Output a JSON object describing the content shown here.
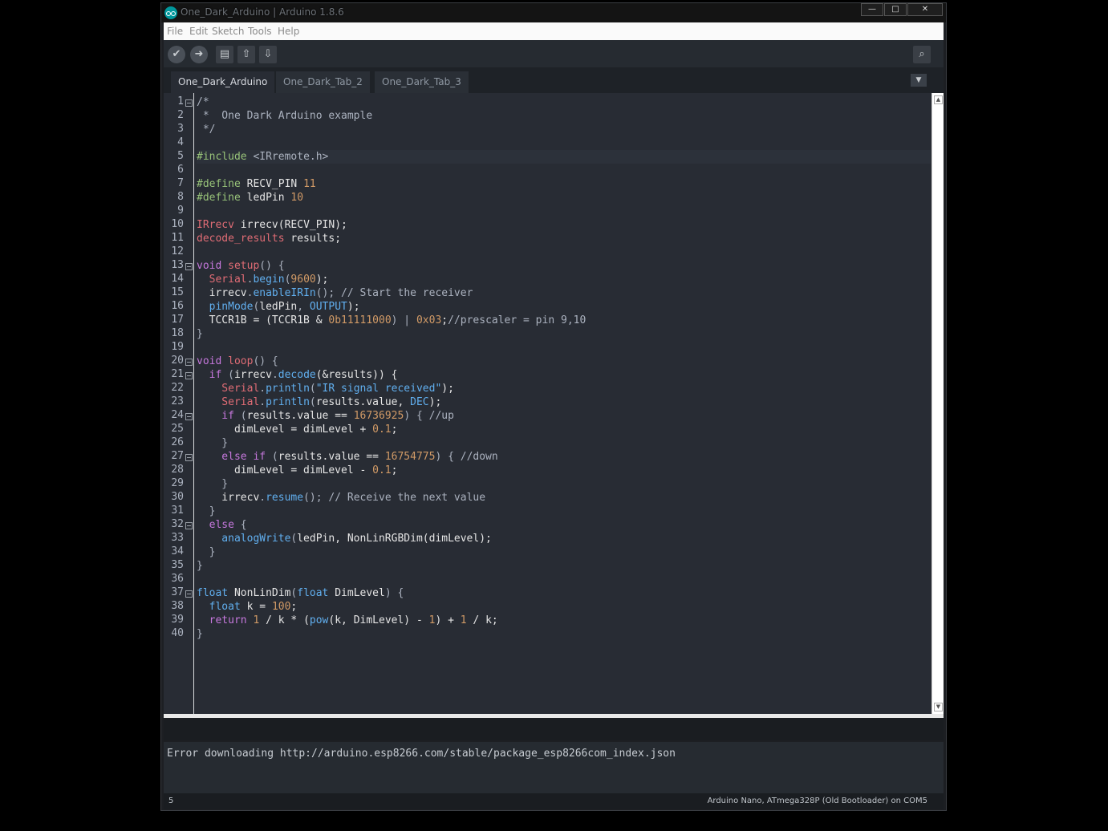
{
  "window": {
    "title": "One_Dark_Arduino | Arduino 1.8.6",
    "controls": {
      "minimize": "—",
      "maximize": "□",
      "close": "✕"
    }
  },
  "menubar": {
    "items": [
      "File",
      "Edit",
      "Sketch",
      "Tools",
      "Help"
    ]
  },
  "toolbar": {
    "verify_icon": "check-icon",
    "upload_icon": "arrow-right-icon",
    "new_icon": "file-icon",
    "open_icon": "arrow-up-icon",
    "save_icon": "arrow-down-icon",
    "serial_monitor_icon": "magnifier-icon"
  },
  "tabs": [
    {
      "label": "One_Dark_Arduino",
      "active": true
    },
    {
      "label": "One_Dark_Tab_2",
      "active": false
    },
    {
      "label": "One_Dark_Tab_3",
      "active": false
    }
  ],
  "editor": {
    "current_line": 5,
    "lines": [
      [
        [
          "/*",
          "#abb2bf"
        ]
      ],
      [
        [
          " *  One Dark Arduino example",
          "#abb2bf"
        ]
      ],
      [
        [
          " */",
          "#abb2bf"
        ]
      ],
      [],
      [
        [
          "#include ",
          "#98c379"
        ],
        [
          "<IRremote.h>",
          "#abb2bf"
        ]
      ],
      [],
      [
        [
          "#define ",
          "#98c379"
        ],
        [
          "RECV_PIN ",
          "#e5e5e5"
        ],
        [
          "11",
          "#d19a66"
        ]
      ],
      [
        [
          "#define ",
          "#98c379"
        ],
        [
          "ledPin ",
          "#e5e5e5"
        ],
        [
          "10",
          "#d19a66"
        ]
      ],
      [],
      [
        [
          "IRrecv ",
          "#e06c75"
        ],
        [
          "irrecv(RECV_PIN);",
          "#e5e5e5"
        ]
      ],
      [
        [
          "decode_results ",
          "#e06c75"
        ],
        [
          "results;",
          "#e5e5e5"
        ]
      ],
      [],
      [
        [
          "void ",
          "#c678dd"
        ],
        [
          "setup",
          "#e06c75"
        ],
        [
          "() {",
          "#abb2bf"
        ]
      ],
      [
        [
          "  Serial",
          "#e06c75"
        ],
        [
          ".",
          "#abb2bf"
        ],
        [
          "begin",
          "#61afef"
        ],
        [
          "(",
          "#abb2bf"
        ],
        [
          "9600",
          "#d19a66"
        ],
        [
          ");",
          "#e5e5e5"
        ]
      ],
      [
        [
          "  irrecv",
          "#e5e5e5"
        ],
        [
          ".",
          "#abb2bf"
        ],
        [
          "enableIRIn",
          "#61afef"
        ],
        [
          "(); ",
          "#abb2bf"
        ],
        [
          "// Start the receiver",
          "#abb2bf"
        ]
      ],
      [
        [
          "  pinMode",
          "#61afef"
        ],
        [
          "(",
          "#abb2bf"
        ],
        [
          "ledPin",
          "#e5e5e5"
        ],
        [
          ", ",
          "#abb2bf"
        ],
        [
          "OUTPUT",
          "#61afef"
        ],
        [
          ");",
          "#e5e5e5"
        ]
      ],
      [
        [
          "  TCCR1B = (TCCR1B & ",
          "#e5e5e5"
        ],
        [
          "0b11111000",
          "#d19a66"
        ],
        [
          ") | ",
          "#abb2bf"
        ],
        [
          "0x03",
          "#d19a66"
        ],
        [
          ";",
          "#e5e5e5"
        ],
        [
          "//prescaler = pin 9,10",
          "#abb2bf"
        ]
      ],
      [
        [
          "}",
          "#abb2bf"
        ]
      ],
      [],
      [
        [
          "void ",
          "#c678dd"
        ],
        [
          "loop",
          "#e06c75"
        ],
        [
          "() {",
          "#abb2bf"
        ]
      ],
      [
        [
          "  if ",
          "#c678dd"
        ],
        [
          "(",
          "#abb2bf"
        ],
        [
          "irrecv",
          "#e5e5e5"
        ],
        [
          ".",
          "#abb2bf"
        ],
        [
          "decode",
          "#61afef"
        ],
        [
          "(&results)) {",
          "#e5e5e5"
        ]
      ],
      [
        [
          "    Serial",
          "#e06c75"
        ],
        [
          ".",
          "#abb2bf"
        ],
        [
          "println",
          "#61afef"
        ],
        [
          "(",
          "#abb2bf"
        ],
        [
          "\"IR signal received\"",
          "#61afef"
        ],
        [
          ");",
          "#e5e5e5"
        ]
      ],
      [
        [
          "    Serial",
          "#e06c75"
        ],
        [
          ".",
          "#abb2bf"
        ],
        [
          "println",
          "#61afef"
        ],
        [
          "(",
          "#abb2bf"
        ],
        [
          "results.value, ",
          "#e5e5e5"
        ],
        [
          "DEC",
          "#61afef"
        ],
        [
          ");",
          "#e5e5e5"
        ]
      ],
      [
        [
          "    if ",
          "#c678dd"
        ],
        [
          "(",
          "#abb2bf"
        ],
        [
          "results.value == ",
          "#e5e5e5"
        ],
        [
          "16736925",
          "#d19a66"
        ],
        [
          ") { ",
          "#abb2bf"
        ],
        [
          "//up",
          "#abb2bf"
        ]
      ],
      [
        [
          "      dimLevel = dimLevel + ",
          "#e5e5e5"
        ],
        [
          "0.1",
          "#d19a66"
        ],
        [
          ";",
          "#e5e5e5"
        ]
      ],
      [
        [
          "    }",
          "#abb2bf"
        ]
      ],
      [
        [
          "    else if ",
          "#c678dd"
        ],
        [
          "(",
          "#abb2bf"
        ],
        [
          "results.value == ",
          "#e5e5e5"
        ],
        [
          "16754775",
          "#d19a66"
        ],
        [
          ") { ",
          "#abb2bf"
        ],
        [
          "//down",
          "#abb2bf"
        ]
      ],
      [
        [
          "      dimLevel = dimLevel - ",
          "#e5e5e5"
        ],
        [
          "0.1",
          "#d19a66"
        ],
        [
          ";",
          "#e5e5e5"
        ]
      ],
      [
        [
          "    }",
          "#abb2bf"
        ]
      ],
      [
        [
          "    irrecv",
          "#e5e5e5"
        ],
        [
          ".",
          "#abb2bf"
        ],
        [
          "resume",
          "#61afef"
        ],
        [
          "(); ",
          "#abb2bf"
        ],
        [
          "// Receive the next value",
          "#abb2bf"
        ]
      ],
      [
        [
          "  }",
          "#abb2bf"
        ]
      ],
      [
        [
          "  else ",
          "#c678dd"
        ],
        [
          "{",
          "#abb2bf"
        ]
      ],
      [
        [
          "    analogWrite",
          "#61afef"
        ],
        [
          "(",
          "#abb2bf"
        ],
        [
          "ledPin, NonLinRGBDim(dimLevel);",
          "#e5e5e5"
        ]
      ],
      [
        [
          "  }",
          "#abb2bf"
        ]
      ],
      [
        [
          "}",
          "#abb2bf"
        ]
      ],
      [],
      [
        [
          "float ",
          "#61afef"
        ],
        [
          "NonLinDim",
          "#e5e5e5"
        ],
        [
          "(",
          "#abb2bf"
        ],
        [
          "float ",
          "#61afef"
        ],
        [
          "DimLevel",
          "#e5e5e5"
        ],
        [
          ") {",
          "#abb2bf"
        ]
      ],
      [
        [
          "  float ",
          "#61afef"
        ],
        [
          "k = ",
          "#e5e5e5"
        ],
        [
          "100",
          "#d19a66"
        ],
        [
          ";",
          "#e5e5e5"
        ]
      ],
      [
        [
          "  return ",
          "#c678dd"
        ],
        [
          "1 ",
          "#d19a66"
        ],
        [
          "/ k * (",
          "#e5e5e5"
        ],
        [
          "pow",
          "#61afef"
        ],
        [
          "(k, DimLevel) - ",
          "#e5e5e5"
        ],
        [
          "1",
          "#d19a66"
        ],
        [
          ") + ",
          "#e5e5e5"
        ],
        [
          "1 ",
          "#d19a66"
        ],
        [
          "/ k;",
          "#e5e5e5"
        ]
      ],
      [
        [
          "}",
          "#abb2bf"
        ]
      ]
    ],
    "fold_lines": [
      1,
      13,
      20,
      21,
      24,
      27,
      32,
      37
    ]
  },
  "console": {
    "message": "Error downloading http://arduino.esp8266.com/stable/package_esp8266com_index.json"
  },
  "status": {
    "line": "5",
    "board": "Arduino Nano, ATmega328P (Old Bootloader) on COM5"
  },
  "colors": {
    "editor_bg": "#282c34",
    "keyword": "#c678dd",
    "function": "#61afef",
    "type": "#e06c75",
    "number": "#d19a66",
    "preprocessor": "#98c379"
  }
}
